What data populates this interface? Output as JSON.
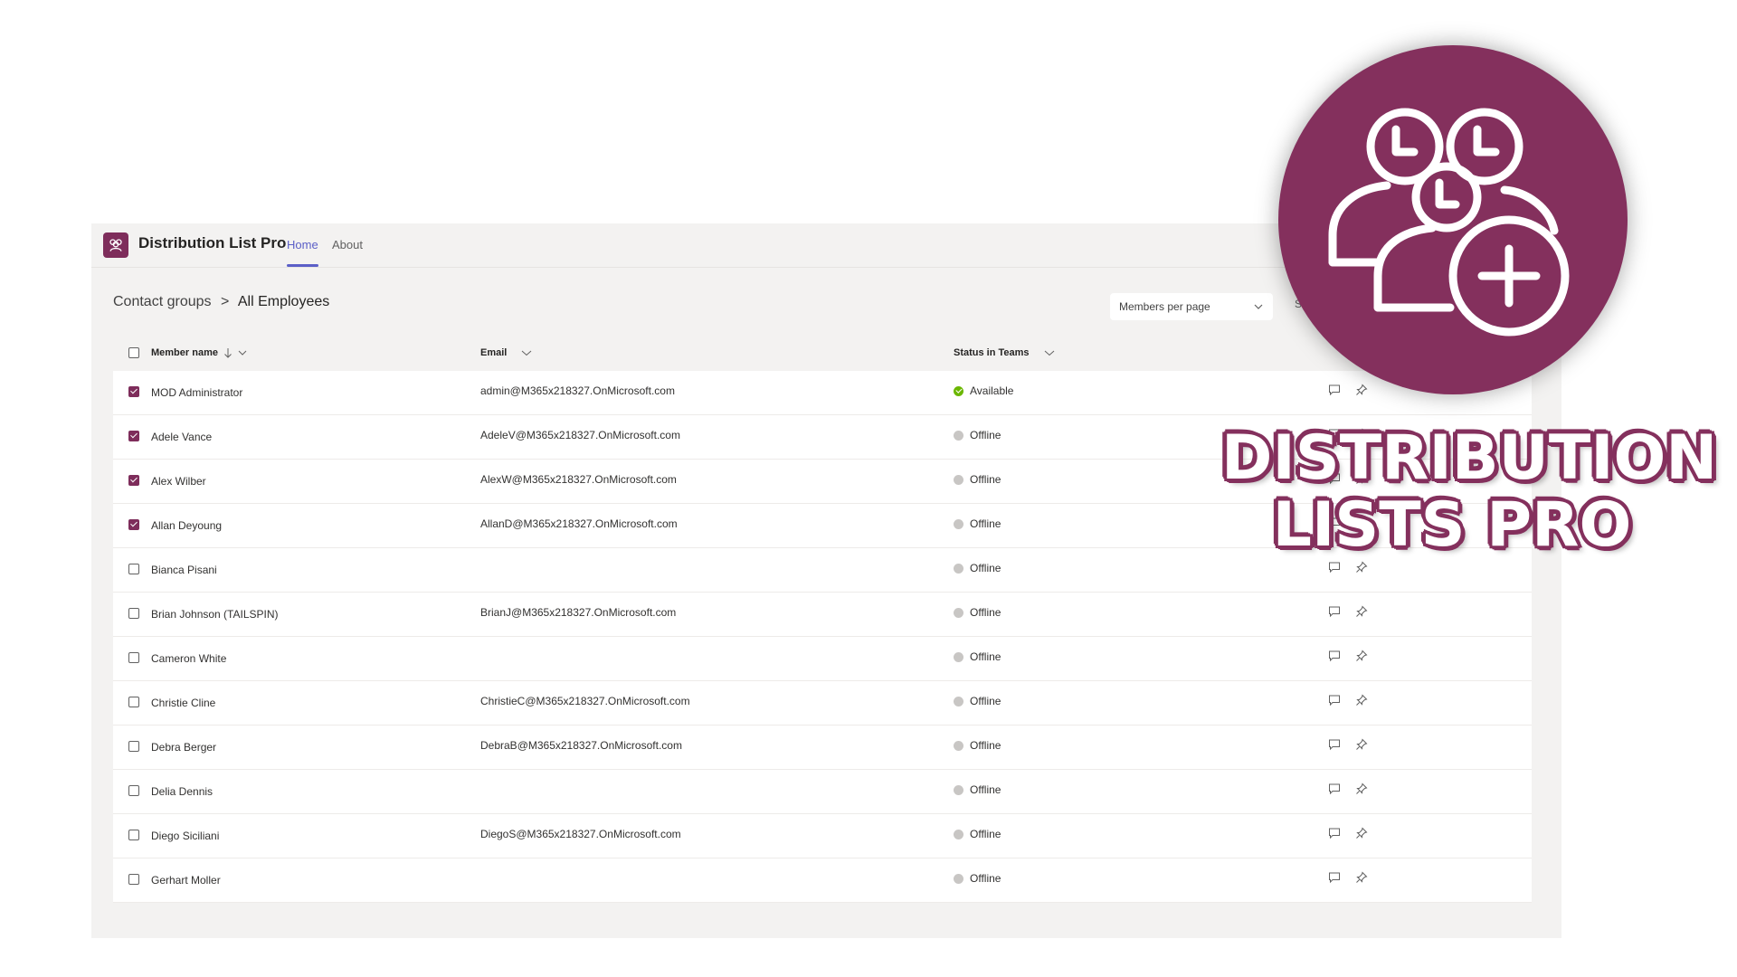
{
  "app": {
    "title": "Distribution List Pro",
    "tabs": [
      {
        "label": "Home",
        "active": true
      },
      {
        "label": "About",
        "active": false
      }
    ],
    "accent": "#7e2d5b",
    "tab_accent": "#5b5fc7"
  },
  "breadcrumb": {
    "parent": "Contact groups",
    "separator": ">",
    "current": "All Employees"
  },
  "controls": {
    "per_page_label": "Members per page",
    "search_stub": "Se"
  },
  "table": {
    "columns": {
      "name": "Member name",
      "email": "Email",
      "status": "Status in Teams"
    },
    "rows": [
      {
        "name": "MOD Administrator",
        "email": "admin@M365x218327.OnMicrosoft.com",
        "status": "Available",
        "checked": true
      },
      {
        "name": "Adele Vance",
        "email": "AdeleV@M365x218327.OnMicrosoft.com",
        "status": "Offline",
        "checked": true
      },
      {
        "name": "Alex Wilber",
        "email": "AlexW@M365x218327.OnMicrosoft.com",
        "status": "Offline",
        "checked": true
      },
      {
        "name": "Allan Deyoung",
        "email": "AllanD@M365x218327.OnMicrosoft.com",
        "status": "Offline",
        "checked": true
      },
      {
        "name": "Bianca Pisani",
        "email": "",
        "status": "Offline",
        "checked": false
      },
      {
        "name": "Brian Johnson (TAILSPIN)",
        "email": "BrianJ@M365x218327.OnMicrosoft.com",
        "status": "Offline",
        "checked": false
      },
      {
        "name": "Cameron White",
        "email": "",
        "status": "Offline",
        "checked": false
      },
      {
        "name": "Christie Cline",
        "email": "ChristieC@M365x218327.OnMicrosoft.com",
        "status": "Offline",
        "checked": false
      },
      {
        "name": "Debra Berger",
        "email": "DebraB@M365x218327.OnMicrosoft.com",
        "status": "Offline",
        "checked": false
      },
      {
        "name": "Delia Dennis",
        "email": "",
        "status": "Offline",
        "checked": false
      },
      {
        "name": "Diego Siciliani",
        "email": "DiegoS@M365x218327.OnMicrosoft.com",
        "status": "Offline",
        "checked": false
      },
      {
        "name": "Gerhart Moller",
        "email": "",
        "status": "Offline",
        "checked": false
      }
    ],
    "status_colors": {
      "Available": "#6bb700",
      "Offline": "#c8c6c4"
    }
  },
  "badge": {
    "line1": "DISTRIBUTION",
    "line2": "LISTS PRO",
    "color": "#84305d",
    "icon": "group-add-icon"
  }
}
